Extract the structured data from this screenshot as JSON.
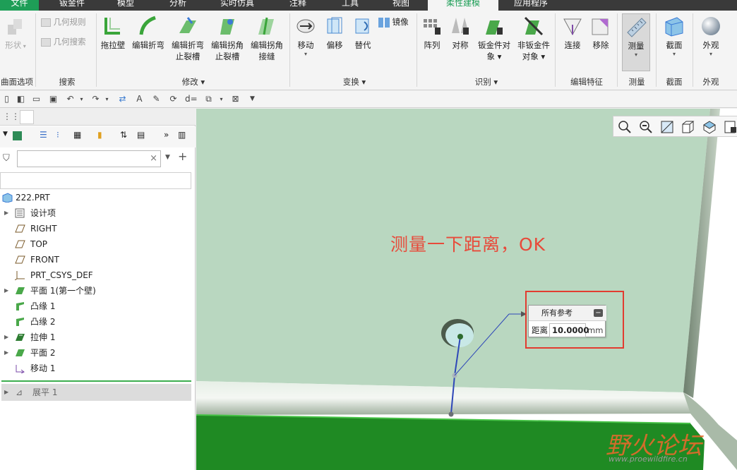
{
  "menu": {
    "tabs": [
      "文件",
      "钣金件",
      "模型",
      "分析",
      "实时仿真",
      "注释",
      "工具",
      "视图",
      "柔性建模",
      "应用程序"
    ],
    "active_tab": "柔性建模"
  },
  "ribbon": {
    "group_left_partial": {
      "shape_btn": "形状",
      "label": "曲面选项"
    },
    "search_group": {
      "geom_rule": "几何规则",
      "geom_search": "几何搜索",
      "label": "搜索"
    },
    "modify_group": {
      "pull_wall": "拖拉壁",
      "edit_bend": "编辑折弯",
      "edit_bend_relief_1": "编辑折弯",
      "edit_bend_relief_2": "止裂槽",
      "edit_corner_relief_1": "编辑拐角",
      "edit_corner_relief_2": "止裂槽",
      "edit_corner_seam_1": "编辑拐角",
      "edit_corner_seam_2": "接缝",
      "label": "修改"
    },
    "transform_group": {
      "mirror": "镜像",
      "move": "移动",
      "offset": "偏移",
      "replace": "替代",
      "label": "变换"
    },
    "recognize_group": {
      "pattern": "阵列",
      "symmetry": "对称",
      "sheetmetal_obj_1": "钣金件对",
      "sheetmetal_obj_2": "象",
      "non_sheetmetal_obj_1": "非钣金件",
      "non_sheetmetal_obj_2": "对象",
      "label": "识别"
    },
    "edit_features_group": {
      "connect": "连接",
      "remove": "移除",
      "label": "编辑特征"
    },
    "measure_group": {
      "measure": "测量",
      "label": "测量"
    },
    "section_group": {
      "section": "截面",
      "label": "截面"
    },
    "appearance_group": {
      "appearance": "外观",
      "label": "外观"
    }
  },
  "model_tree": {
    "root": "222.PRT",
    "items": [
      "设计项",
      "RIGHT",
      "TOP",
      "FRONT",
      "PRT_CSYS_DEF",
      "平面 1(第一个壁)",
      "凸缘 1",
      "凸缘 2",
      "拉伸 1",
      "平面 2",
      "移动 1"
    ],
    "flat": "展平 1",
    "search_placeholder": ""
  },
  "viewport": {
    "annotation": "测量一下距离，OK",
    "measure": {
      "header": "所有参考",
      "label": "距离",
      "value": "10.0000",
      "unit": "mm"
    }
  },
  "watermark": {
    "cn": "野火论坛",
    "url": "www.proewildfire.cn"
  },
  "colors": {
    "accent": "#1e9e57",
    "annotation": "#e84a3a",
    "plate": "#b8d8c0",
    "edge_green": "#1d8a1d"
  }
}
